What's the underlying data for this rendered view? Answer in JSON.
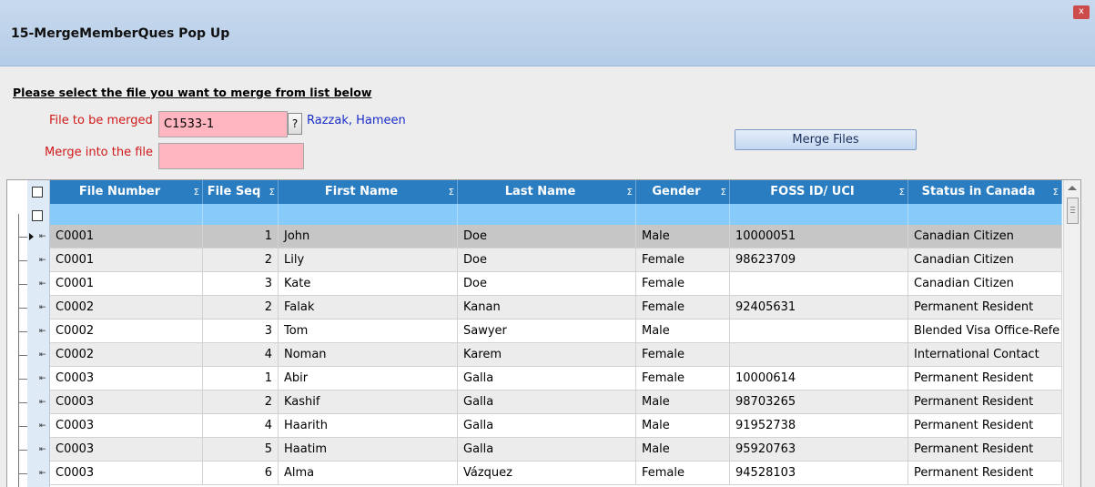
{
  "window": {
    "title": "15-MergeMemberQues Pop Up",
    "close_label": "x"
  },
  "form": {
    "instruction": "Please select the file you want to merge from list below",
    "file_to_merge_label": "File to be merged",
    "file_to_merge_value": "C1533-1",
    "lookup_label": "?",
    "member_name": "Razzak, Hameen",
    "merge_into_label": "Merge into the file",
    "merge_into_value": "",
    "merge_button": "Merge Files"
  },
  "grid": {
    "columns": [
      {
        "label": "File Number",
        "sigma": "Σ"
      },
      {
        "label": "File Seq",
        "sigma": "Σ"
      },
      {
        "label": "First Name",
        "sigma": "Σ"
      },
      {
        "label": "Last Name",
        "sigma": "Σ"
      },
      {
        "label": "Gender",
        "sigma": "Σ"
      },
      {
        "label": "FOSS ID/ UCI",
        "sigma": "Σ"
      },
      {
        "label": "Status in Canada",
        "sigma": "Σ"
      }
    ],
    "selected_row": 0,
    "rows": [
      {
        "file_number": "C0001",
        "file_seq": "1",
        "first_name": "John",
        "last_name": "Doe",
        "gender": "Male",
        "foss_id": "10000051",
        "status": "Canadian Citizen"
      },
      {
        "file_number": "C0001",
        "file_seq": "2",
        "first_name": "Lily",
        "last_name": "Doe",
        "gender": "Female",
        "foss_id": "98623709",
        "status": "Canadian Citizen"
      },
      {
        "file_number": "C0001",
        "file_seq": "3",
        "first_name": "Kate",
        "last_name": "Doe",
        "gender": "Female",
        "foss_id": "",
        "status": "Canadian Citizen"
      },
      {
        "file_number": "C0002",
        "file_seq": "2",
        "first_name": "Falak",
        "last_name": "Kanan",
        "gender": "Female",
        "foss_id": "92405631",
        "status": "Permanent Resident"
      },
      {
        "file_number": "C0002",
        "file_seq": "3",
        "first_name": "Tom",
        "last_name": "Sawyer",
        "gender": "Male",
        "foss_id": "",
        "status": "Blended Visa Office-Refe"
      },
      {
        "file_number": "C0002",
        "file_seq": "4",
        "first_name": "Noman",
        "last_name": "Karem",
        "gender": "Female",
        "foss_id": "",
        "status": "International Contact"
      },
      {
        "file_number": "C0003",
        "file_seq": "1",
        "first_name": "Abir",
        "last_name": "Galla",
        "gender": "Female",
        "foss_id": "10000614",
        "status": "Permanent Resident"
      },
      {
        "file_number": "C0003",
        "file_seq": "2",
        "first_name": "Kashif",
        "last_name": "Galla",
        "gender": "Male",
        "foss_id": "98703265",
        "status": "Permanent Resident"
      },
      {
        "file_number": "C0003",
        "file_seq": "4",
        "first_name": "Haarith",
        "last_name": "Galla",
        "gender": "Male",
        "foss_id": "91952738",
        "status": "Permanent Resident"
      },
      {
        "file_number": "C0003",
        "file_seq": "5",
        "first_name": "Haatim",
        "last_name": "Galla",
        "gender": "Male",
        "foss_id": "95920763",
        "status": "Permanent Resident"
      },
      {
        "file_number": "C0003",
        "file_seq": "6",
        "first_name": "Alma",
        "last_name": "Vázquez",
        "gender": "Female",
        "foss_id": "94528103",
        "status": "Permanent Resident"
      }
    ]
  },
  "colors": {
    "header": "#2b7dc2",
    "filter_row": "#87cbfa",
    "selected_row": "#c6c6c6",
    "alt_row": "#ececec",
    "required_field": "#ffb6c1",
    "label_red": "#d01818",
    "link_blue": "#1a2dc8"
  }
}
